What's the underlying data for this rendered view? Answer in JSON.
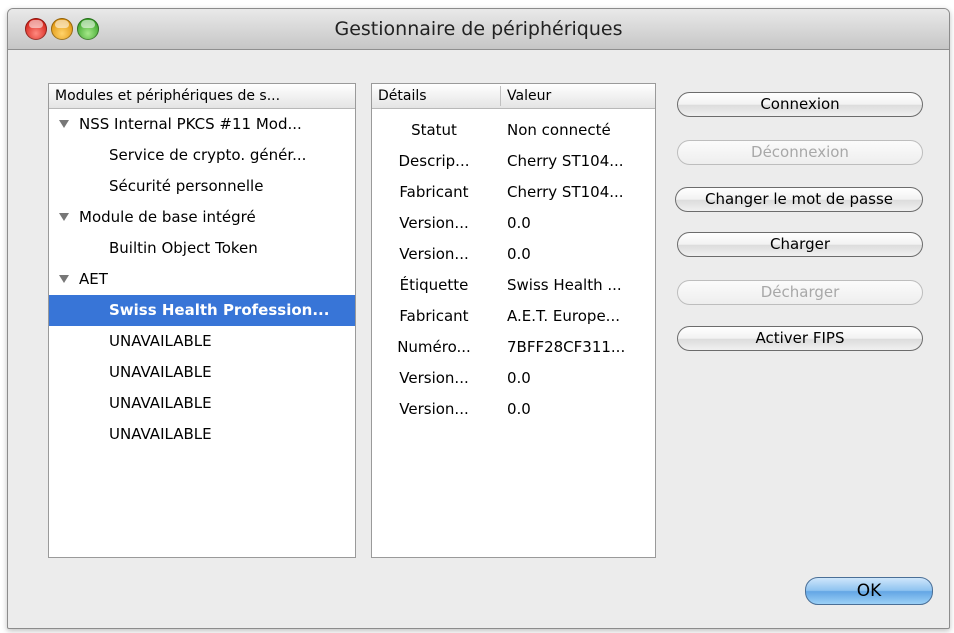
{
  "window": {
    "title": "Gestionnaire de périphériques"
  },
  "modules_panel": {
    "header": "Modules et périphériques de s...",
    "rows": [
      {
        "label": "NSS Internal PKCS #11 Mod...",
        "level": 0,
        "expanded": true,
        "selected": false
      },
      {
        "label": "Service de crypto. génér...",
        "level": 1,
        "selected": false
      },
      {
        "label": "Sécurité personnelle",
        "level": 1,
        "selected": false
      },
      {
        "label": "Module de base intégré",
        "level": 0,
        "expanded": true,
        "selected": false
      },
      {
        "label": "Builtin Object Token",
        "level": 1,
        "selected": false
      },
      {
        "label": "AET",
        "level": 0,
        "expanded": true,
        "selected": false
      },
      {
        "label": "Swiss Health Profession...",
        "level": 1,
        "selected": true
      },
      {
        "label": "UNAVAILABLE",
        "level": 1,
        "selected": false
      },
      {
        "label": "UNAVAILABLE",
        "level": 1,
        "selected": false
      },
      {
        "label": "UNAVAILABLE",
        "level": 1,
        "selected": false
      },
      {
        "label": "UNAVAILABLE",
        "level": 1,
        "selected": false
      }
    ]
  },
  "details_panel": {
    "headers": {
      "details": "Détails",
      "value": "Valeur"
    },
    "rows": [
      {
        "detail": "Statut",
        "value": "Non connecté"
      },
      {
        "detail": "Descrip...",
        "value": "Cherry ST104..."
      },
      {
        "detail": "Fabricant",
        "value": "Cherry ST104..."
      },
      {
        "detail": "Version...",
        "value": "0.0"
      },
      {
        "detail": "Version...",
        "value": "0.0"
      },
      {
        "detail": "Étiquette",
        "value": "Swiss Health ..."
      },
      {
        "detail": "Fabricant",
        "value": "A.E.T. Europe..."
      },
      {
        "detail": "Numéro...",
        "value": "7BFF28CF311..."
      },
      {
        "detail": "Version...",
        "value": "0.0"
      },
      {
        "detail": "Version...",
        "value": "0.0"
      }
    ]
  },
  "buttons": {
    "connexion": "Connexion",
    "deconnexion": "Déconnexion",
    "changer_mdp": "Changer le mot de passe",
    "charger": "Charger",
    "decharger": "Décharger",
    "activer_fips": "Activer FIPS",
    "ok": "OK"
  },
  "colors": {
    "selection": "#3875d7",
    "default_button": "#63a6e5"
  }
}
